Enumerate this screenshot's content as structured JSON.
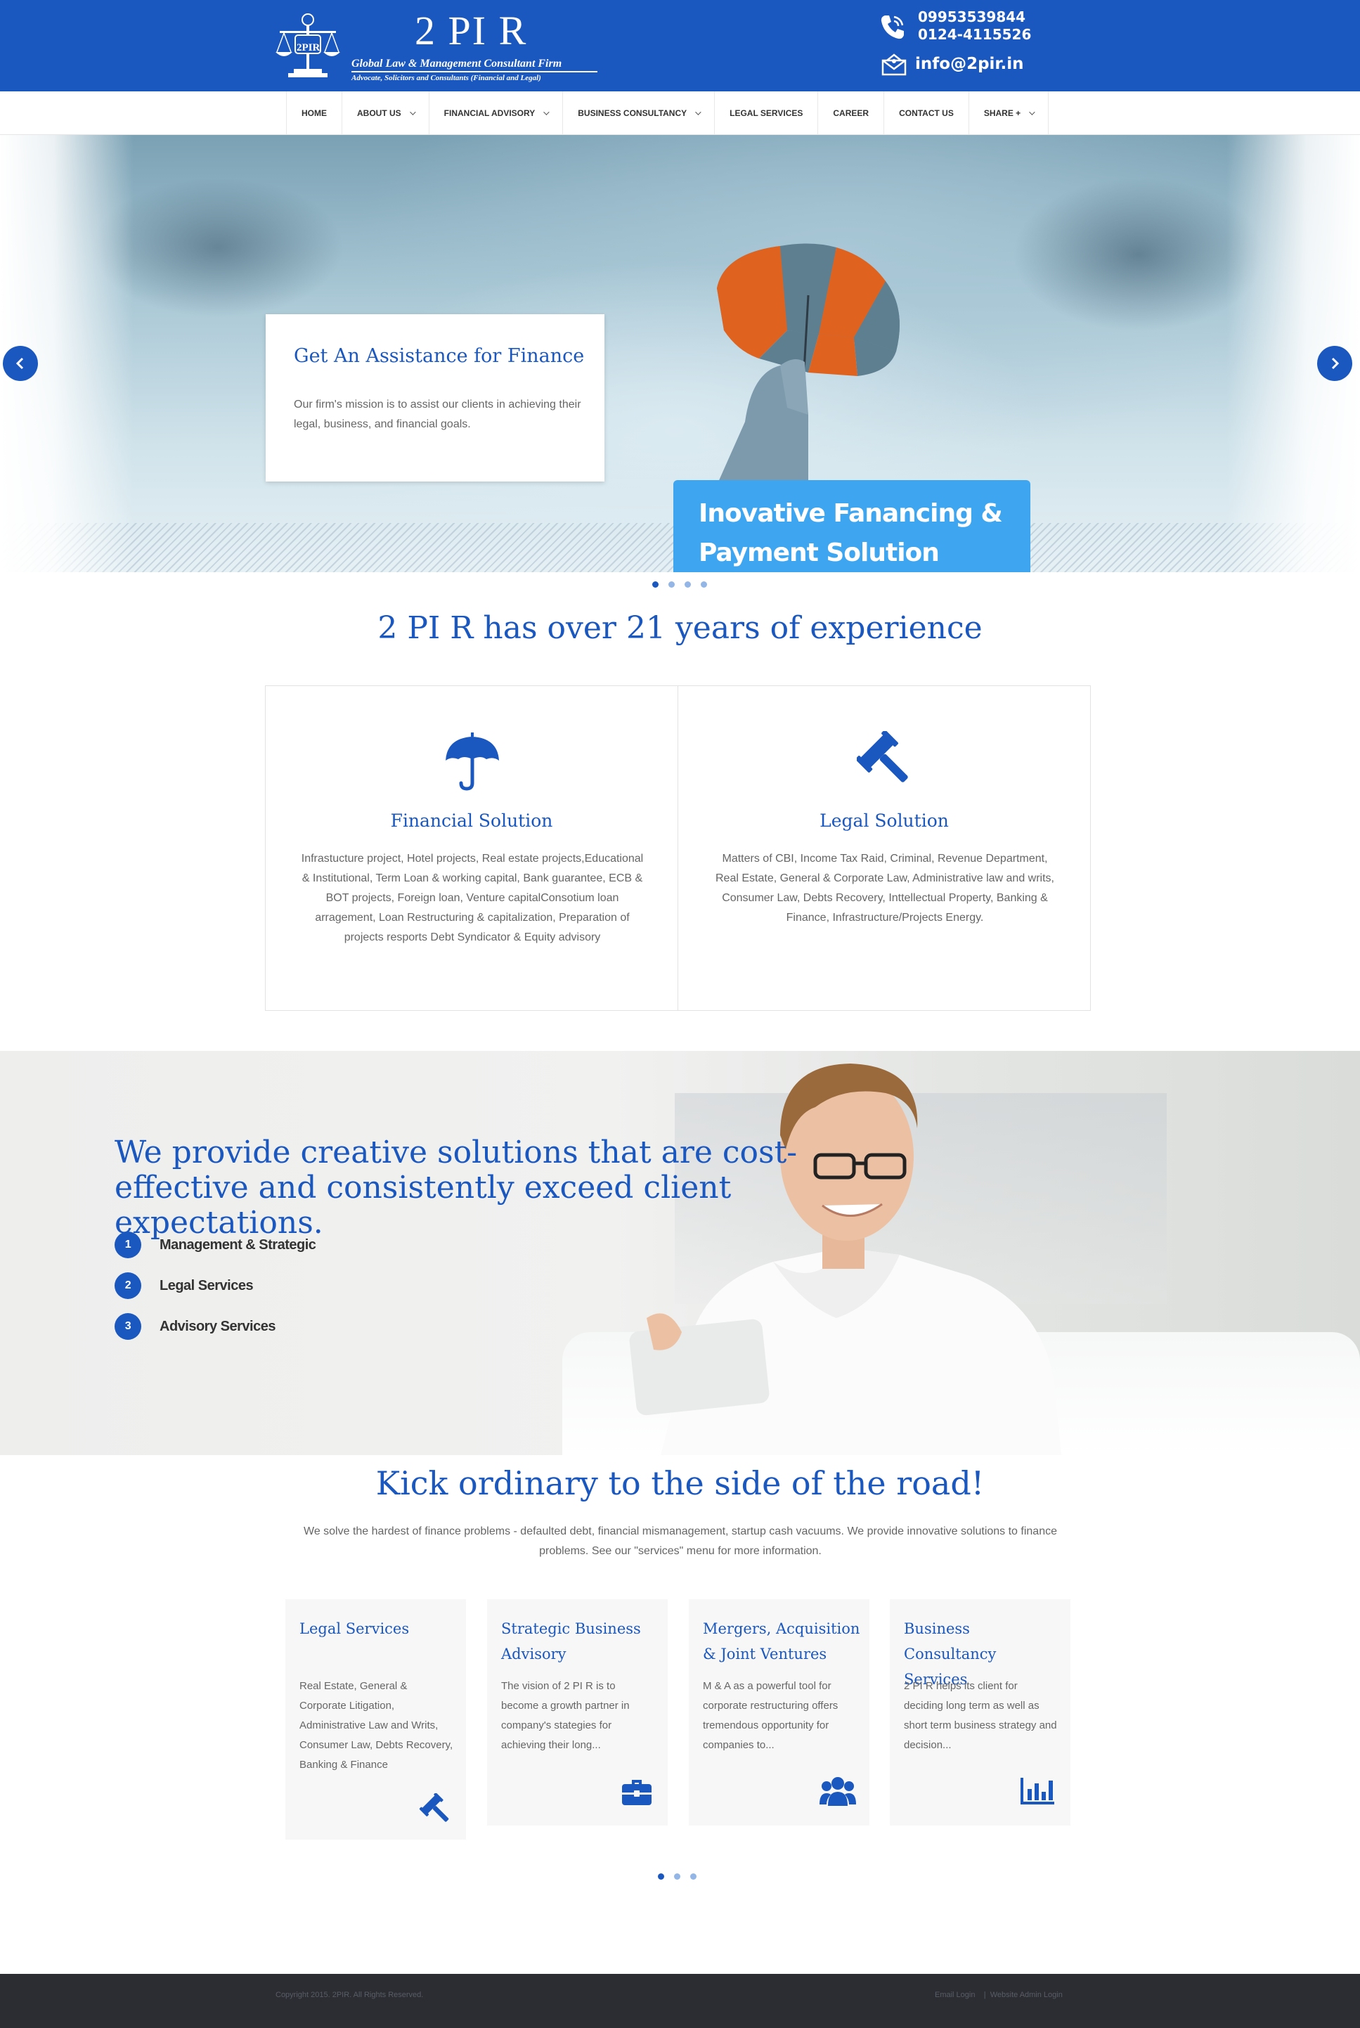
{
  "header": {
    "logo_title": "2 PI R",
    "logo_tagline": "Global Law & Management Consultant Firm",
    "logo_subtagline": "Advocate, Solicitors and Consultants (Financial and Legal)",
    "logo_badge": "2PIR",
    "phone1": "09953539844",
    "phone2": "0124-4115526",
    "email": "info@2pir.in"
  },
  "nav": {
    "items": [
      {
        "label": "HOME"
      },
      {
        "label": "ABOUT US"
      },
      {
        "label": "FINANCIAL ADVISORY"
      },
      {
        "label": "BUSINESS CONSULTANCY"
      },
      {
        "label": "LEGAL SERVICES"
      },
      {
        "label": "CAREER"
      },
      {
        "label": "CONTACT US"
      },
      {
        "label": "SHARE +"
      }
    ]
  },
  "hero": {
    "card_title": "Get An Assistance for Finance",
    "card_text": "Our firm's mission is to assist our clients in achieving their legal, business, and financial goals.",
    "badge": "Inovative Fanancing & Payment Solution",
    "slide_count": 4,
    "active_slide": 1
  },
  "experience": {
    "title": "2 PI R has over 21 years of experience",
    "boxes": [
      {
        "title": "Financial Solution",
        "icon": "umbrella-icon",
        "text": "Infrastucture project, Hotel projects, Real estate projects,Educational & Institutional, Term Loan & working capital, Bank guarantee, ECB & BOT projects, Foreign loan, Venture capitalConsotium loan arragement, Loan Restructuring & capitalization, Preparation of projects resports Debt Syndicator & Equity advisory"
      },
      {
        "title": "Legal Solution",
        "icon": "gavel-icon",
        "text": "Matters of CBI, Income Tax Raid, Criminal, Revenue Department, Real Estate, General & Corporate Law, Administrative law and writs, Consumer Law, Debts Recovery, Inttellectual Property, Banking & Finance, Infrastructure/Projects Energy."
      }
    ]
  },
  "creative": {
    "title": "We provide creative solutions that are cost-effective and consistently exceed client expectations.",
    "items": [
      {
        "num": "1",
        "label": "Management & Strategic"
      },
      {
        "num": "2",
        "label": "Legal Services"
      },
      {
        "num": "3",
        "label": "Advisory Services"
      }
    ]
  },
  "kick": {
    "title": "Kick ordinary to the side of the road!",
    "description": "We solve the hardest of finance problems - defaulted debt, financial mismanagement, startup cash vacuums. We provide innovative solutions to finance problems. See our \"services\" menu for more information.",
    "services": [
      {
        "title": "Legal Services",
        "text": "Real Estate, General & Corporate Litigation, Administrative Law and Writs, Consumer Law, Debts Recovery, Banking & Finance",
        "icon": "gavel-icon"
      },
      {
        "title": "Strategic Business Advisory",
        "text": "The vision of 2 PI R is to become a growth partner in company's stategies for achieving their long...",
        "icon": "briefcase-icon"
      },
      {
        "title": "Mergers, Acquisition & Joint Ventures",
        "text": "M & A as a powerful tool for corporate restructuring offers tremendous opportunity for companies to...",
        "icon": "users-icon"
      },
      {
        "title": "Business Consultancy Services",
        "text": "2 PI R helps its client for deciding long term as well as short term business strategy and decision...",
        "icon": "bar-chart-icon"
      }
    ],
    "page_count": 3,
    "active_page": 1
  },
  "footer": {
    "copyright": "Copyright 2015. 2PIR. All Rights Reserved.",
    "email_login": "Email Login",
    "separator": "|",
    "admin_login": "Website Admin Login"
  },
  "colors": {
    "brand_blue": "#1a57bf",
    "badge_blue": "#3ea6f0",
    "footer_bg": "#2b2d33"
  }
}
